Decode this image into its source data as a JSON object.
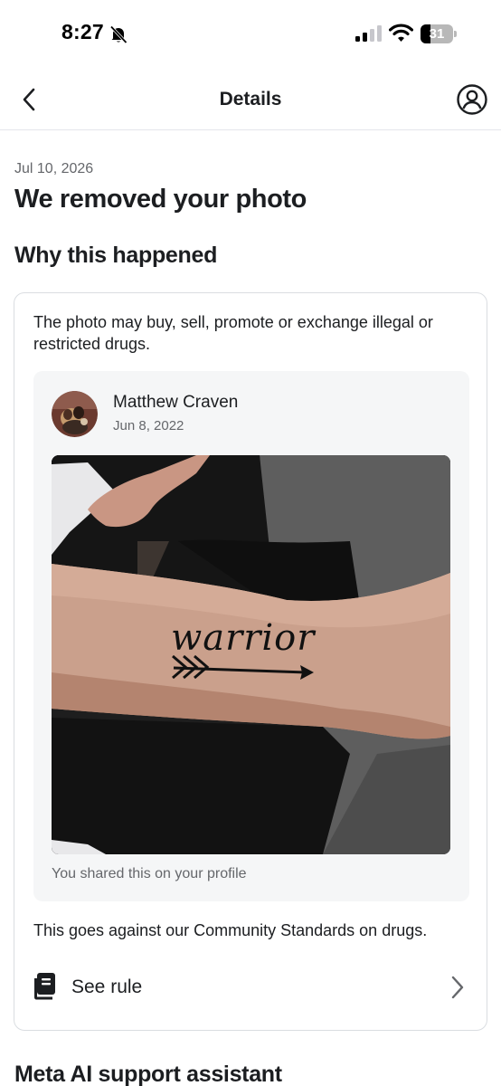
{
  "status_bar": {
    "time": "8:27",
    "battery_percent": 31,
    "icons": [
      "bell-slash-icon",
      "signal-icon",
      "wifi-icon",
      "battery-icon"
    ]
  },
  "header": {
    "title": "Details",
    "back_icon": "chevron-left-icon",
    "profile_icon": "person-circle-icon"
  },
  "notice": {
    "date": "Jul 10, 2026",
    "title": "We removed your photo",
    "section_title": "Why this happened",
    "reason": "The photo may buy, sell, promote or exchange illegal or restricted drugs.",
    "post": {
      "author": "Matthew Craven",
      "date": "Jun 8, 2022",
      "photo_text": "warrior",
      "caption": "You shared this on your profile"
    },
    "standards_text": "This goes against our Community Standards on drugs.",
    "see_rule_label": "See rule"
  },
  "next_section": {
    "title": "Meta AI support assistant"
  },
  "colors": {
    "text_primary": "#1c1e21",
    "text_secondary": "#65676b",
    "card_border": "#dadde1",
    "post_background": "#f5f6f7"
  }
}
